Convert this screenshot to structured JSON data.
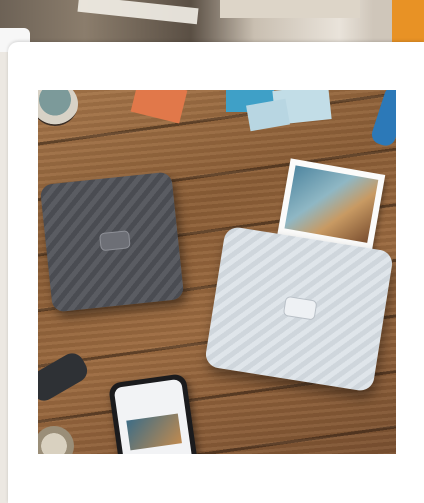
{
  "page": {
    "background_color": "#ece8e2",
    "accent_color": "#e89225",
    "card_color": "#ffffff"
  },
  "product_image": {
    "subject": "product-photo",
    "contents": [
      "dark-gray-printer",
      "light-gray-printer",
      "instant-photo-print",
      "smartphone",
      "wooden-table"
    ]
  }
}
